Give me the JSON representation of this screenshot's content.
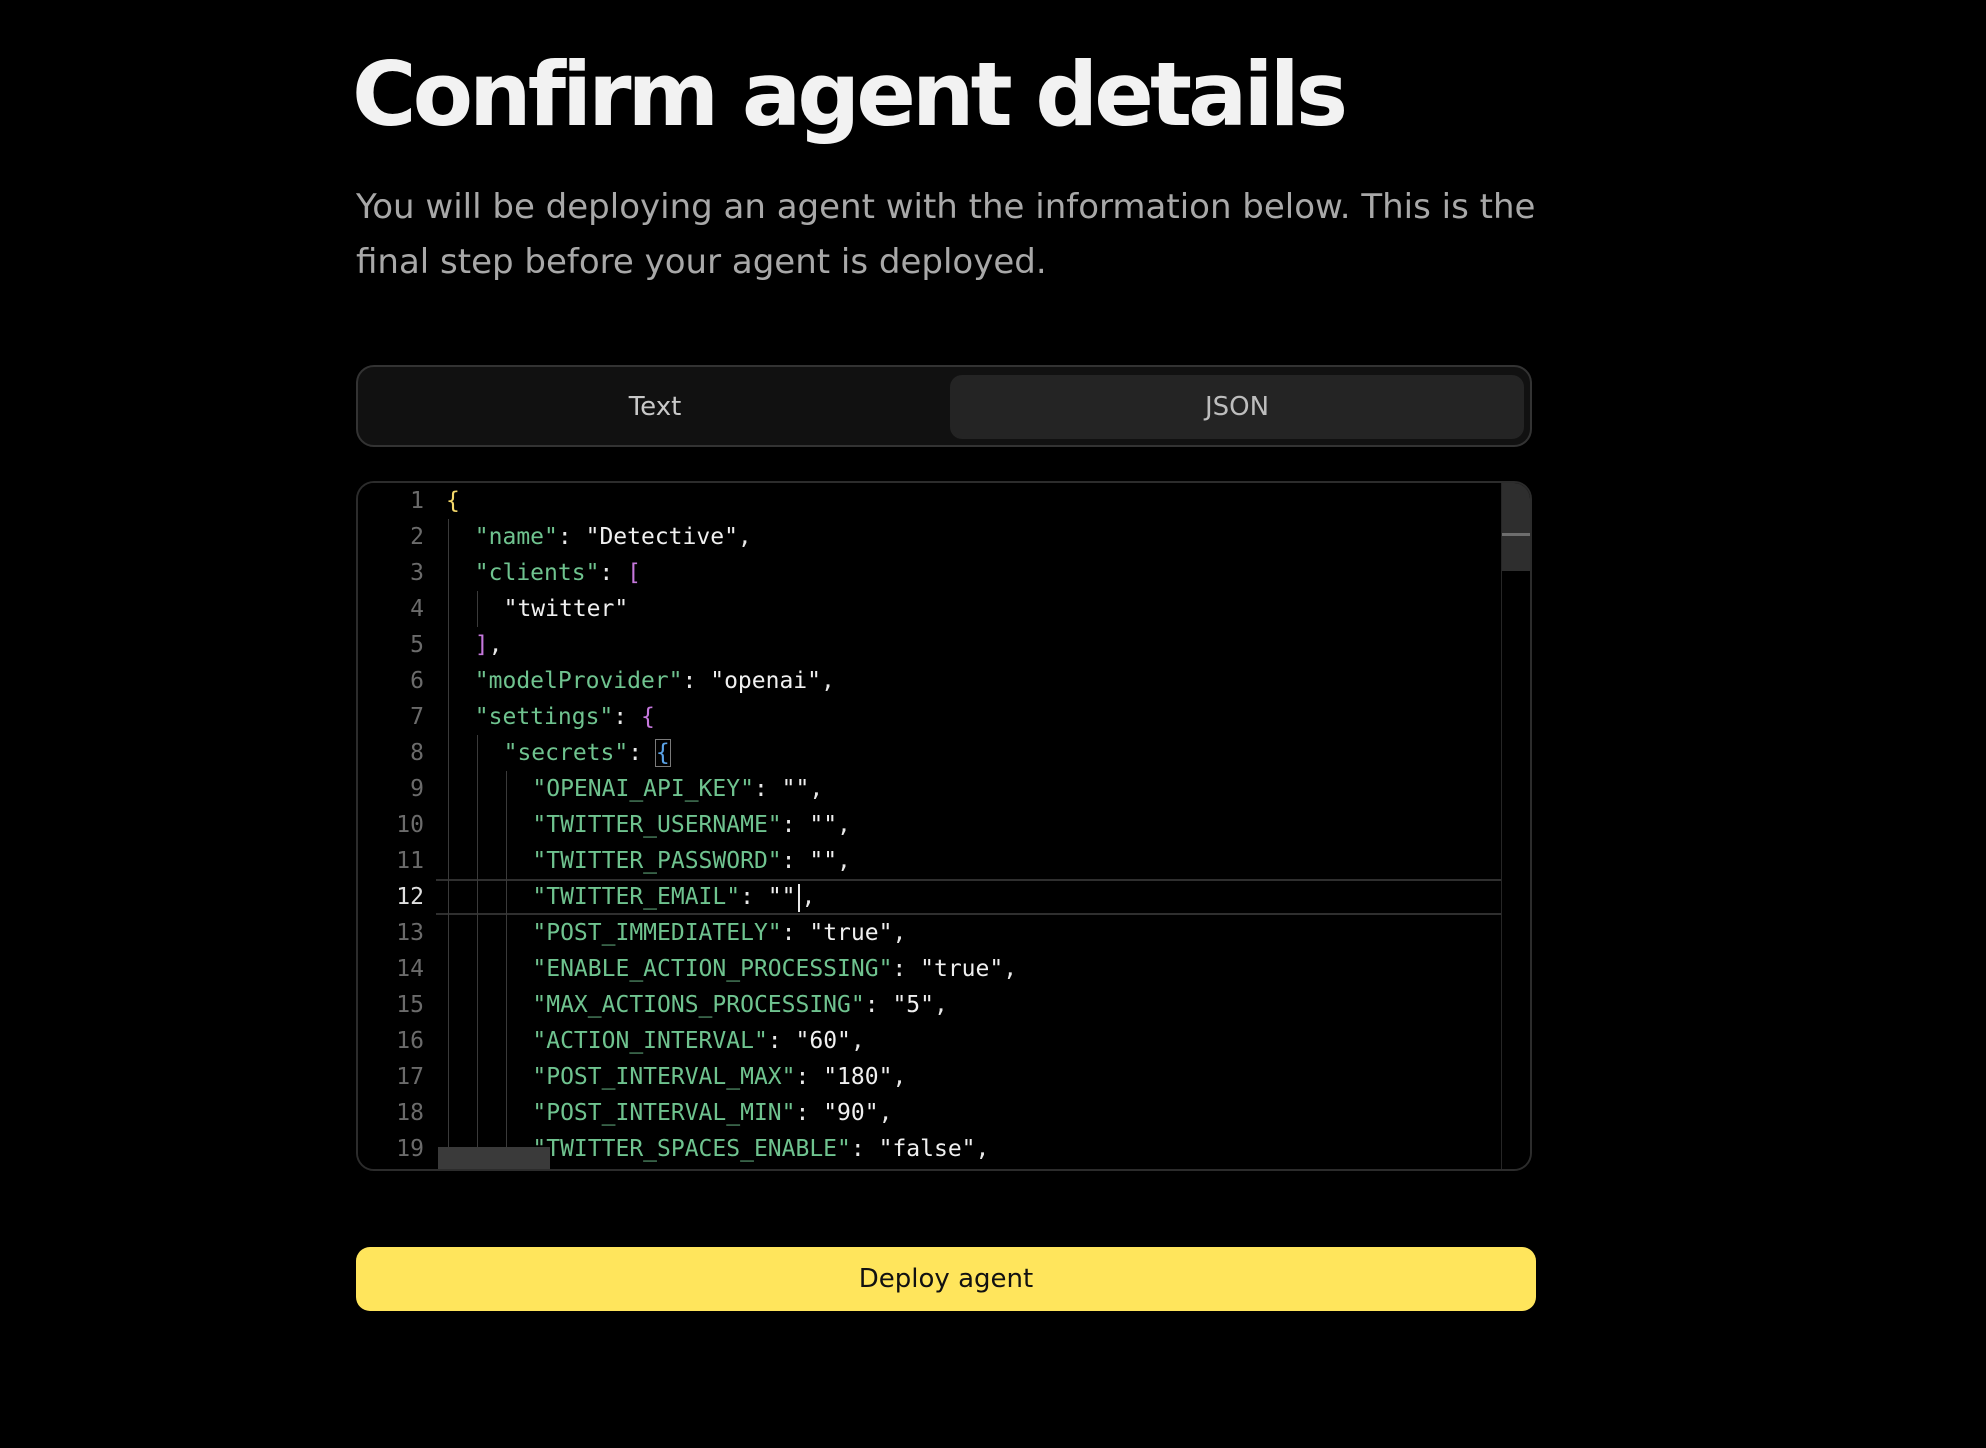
{
  "header": {
    "title": "Confirm agent details",
    "subtitle": "You will be deploying an agent with the information below. This is the final step before your agent is deployed."
  },
  "tabs": [
    {
      "label": "Text",
      "selected": false
    },
    {
      "label": "JSON",
      "selected": true
    }
  ],
  "editor": {
    "current_line": 12,
    "line_numbers": [
      "1",
      "2",
      "3",
      "4",
      "5",
      "6",
      "7",
      "8",
      "9",
      "10",
      "11",
      "12",
      "13",
      "14",
      "15",
      "16",
      "17",
      "18",
      "19"
    ],
    "lines": [
      {
        "tokens": [
          {
            "t": "{",
            "c": "b1"
          }
        ]
      },
      {
        "tokens": [
          {
            "t": "\"name\"",
            "c": "k"
          },
          {
            "t": ": ",
            "c": "p"
          },
          {
            "t": "\"Detective\"",
            "c": "s"
          },
          {
            "t": ",",
            "c": "p"
          }
        ]
      },
      {
        "tokens": [
          {
            "t": "\"clients\"",
            "c": "k"
          },
          {
            "t": ": ",
            "c": "p"
          },
          {
            "t": "[",
            "c": "b2"
          }
        ]
      },
      {
        "tokens": [
          {
            "t": "\"twitter\"",
            "c": "s"
          }
        ]
      },
      {
        "tokens": [
          {
            "t": "]",
            "c": "b2"
          },
          {
            "t": ",",
            "c": "p"
          }
        ]
      },
      {
        "tokens": [
          {
            "t": "\"modelProvider\"",
            "c": "k"
          },
          {
            "t": ": ",
            "c": "p"
          },
          {
            "t": "\"openai\"",
            "c": "s"
          },
          {
            "t": ",",
            "c": "p"
          }
        ]
      },
      {
        "tokens": [
          {
            "t": "\"settings\"",
            "c": "k"
          },
          {
            "t": ": ",
            "c": "p"
          },
          {
            "t": "{",
            "c": "b2"
          }
        ]
      },
      {
        "tokens": [
          {
            "t": "\"secrets\"",
            "c": "k"
          },
          {
            "t": ": ",
            "c": "p"
          },
          {
            "t": "{",
            "c": "b3"
          }
        ]
      },
      {
        "tokens": [
          {
            "t": "\"OPENAI_API_KEY\"",
            "c": "k"
          },
          {
            "t": ": ",
            "c": "p"
          },
          {
            "t": "\"\"",
            "c": "s"
          },
          {
            "t": ",",
            "c": "p"
          }
        ]
      },
      {
        "tokens": [
          {
            "t": "\"TWITTER_USERNAME\"",
            "c": "k"
          },
          {
            "t": ": ",
            "c": "p"
          },
          {
            "t": "\"\"",
            "c": "s"
          },
          {
            "t": ",",
            "c": "p"
          }
        ]
      },
      {
        "tokens": [
          {
            "t": "\"TWITTER_PASSWORD\"",
            "c": "k"
          },
          {
            "t": ": ",
            "c": "p"
          },
          {
            "t": "\"\"",
            "c": "s"
          },
          {
            "t": ",",
            "c": "p"
          }
        ]
      },
      {
        "tokens": [
          {
            "t": "\"TWITTER_EMAIL\"",
            "c": "k"
          },
          {
            "t": ": ",
            "c": "p"
          },
          {
            "t": "\"\"",
            "c": "s"
          },
          {
            "t": ",",
            "c": "p"
          }
        ]
      },
      {
        "tokens": [
          {
            "t": "\"POST_IMMEDIATELY\"",
            "c": "k"
          },
          {
            "t": ": ",
            "c": "p"
          },
          {
            "t": "\"true\"",
            "c": "s"
          },
          {
            "t": ",",
            "c": "p"
          }
        ]
      },
      {
        "tokens": [
          {
            "t": "\"ENABLE_ACTION_PROCESSING\"",
            "c": "k"
          },
          {
            "t": ": ",
            "c": "p"
          },
          {
            "t": "\"true\"",
            "c": "s"
          },
          {
            "t": ",",
            "c": "p"
          }
        ]
      },
      {
        "tokens": [
          {
            "t": "\"MAX_ACTIONS_PROCESSING\"",
            "c": "k"
          },
          {
            "t": ": ",
            "c": "p"
          },
          {
            "t": "\"5\"",
            "c": "s"
          },
          {
            "t": ",",
            "c": "p"
          }
        ]
      },
      {
        "tokens": [
          {
            "t": "\"ACTION_INTERVAL\"",
            "c": "k"
          },
          {
            "t": ": ",
            "c": "p"
          },
          {
            "t": "\"60\"",
            "c": "s"
          },
          {
            "t": ",",
            "c": "p"
          }
        ]
      },
      {
        "tokens": [
          {
            "t": "\"POST_INTERVAL_MAX\"",
            "c": "k"
          },
          {
            "t": ": ",
            "c": "p"
          },
          {
            "t": "\"180\"",
            "c": "s"
          },
          {
            "t": ",",
            "c": "p"
          }
        ]
      },
      {
        "tokens": [
          {
            "t": "\"POST_INTERVAL_MIN\"",
            "c": "k"
          },
          {
            "t": ": ",
            "c": "p"
          },
          {
            "t": "\"90\"",
            "c": "s"
          },
          {
            "t": ",",
            "c": "p"
          }
        ]
      },
      {
        "tokens": [
          {
            "t": "\"TWITTER_SPACES_ENABLE\"",
            "c": "k"
          },
          {
            "t": ": ",
            "c": "p"
          },
          {
            "t": "\"false\"",
            "c": "s"
          },
          {
            "t": ",",
            "c": "p"
          }
        ]
      }
    ]
  },
  "deploy": {
    "label": "Deploy agent"
  },
  "colors": {
    "accent": "#ffe55c",
    "key": "#6fc38f",
    "bracket_level1": "#f4d86a",
    "bracket_level2": "#c678dd",
    "bracket_level3": "#5aa3e8"
  }
}
